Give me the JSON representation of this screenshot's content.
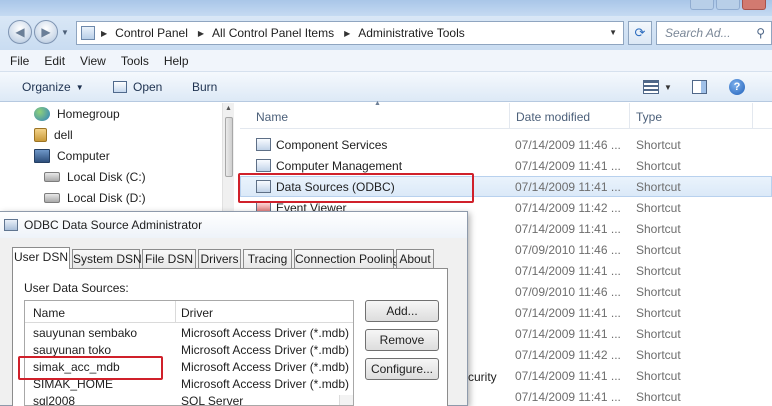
{
  "explorer": {
    "breadcrumb": [
      "Control Panel",
      "All Control Panel Items",
      "Administrative Tools"
    ],
    "search_placeholder": "Search Ad...",
    "menu": [
      "File",
      "Edit",
      "View",
      "Tools",
      "Help"
    ],
    "toolbar": {
      "organize": "Organize",
      "open": "Open",
      "burn": "Burn"
    },
    "nav": [
      {
        "label": "Homegroup",
        "icon": "homegroup-icon"
      },
      {
        "label": "dell",
        "icon": "user-folder-icon"
      },
      {
        "label": "Computer",
        "icon": "computer-icon"
      },
      {
        "label": "Local Disk (C:)",
        "icon": "disk-icon"
      },
      {
        "label": "Local Disk (D:)",
        "icon": "disk-icon"
      }
    ],
    "columns": {
      "name": "Name",
      "date": "Date modified",
      "type": "Type"
    },
    "files": [
      {
        "name": "Component Services",
        "date": "07/14/2009 11:46 ...",
        "type": "Shortcut"
      },
      {
        "name": "Computer Management",
        "date": "07/14/2009 11:41 ...",
        "type": "Shortcut"
      },
      {
        "name": "Data Sources (ODBC)",
        "date": "07/14/2009 11:41 ...",
        "type": "Shortcut"
      },
      {
        "name": "Event Viewer",
        "date": "07/14/2009 11:42 ...",
        "type": "Shortcut"
      },
      {
        "name": "",
        "date": "07/14/2009 11:41 ...",
        "type": "Shortcut"
      },
      {
        "name": "",
        "date": "07/09/2010 11:46 ...",
        "type": "Shortcut"
      },
      {
        "name": "",
        "date": "07/14/2009 11:41 ...",
        "type": "Shortcut"
      },
      {
        "name": "",
        "date": "07/09/2010 11:46 ...",
        "type": "Shortcut"
      },
      {
        "name": "",
        "date": "07/14/2009 11:41 ...",
        "type": "Shortcut"
      },
      {
        "name": "",
        "date": "07/14/2009 11:41 ...",
        "type": "Shortcut"
      },
      {
        "name": "",
        "date": "07/14/2009 11:42 ...",
        "type": "Shortcut"
      },
      {
        "name": "",
        "date": "07/14/2009 11:41 ...",
        "type": "Shortcut"
      },
      {
        "name": "",
        "date": "07/14/2009 11:41 ...",
        "type": "Shortcut"
      }
    ],
    "partial_text": "curity"
  },
  "dialog": {
    "title": "ODBC Data Source Administrator",
    "tabs": [
      "User DSN",
      "System DSN",
      "File DSN",
      "Drivers",
      "Tracing",
      "Connection Pooling",
      "About"
    ],
    "list_label": "User Data Sources:",
    "list_columns": {
      "name": "Name",
      "driver": "Driver"
    },
    "rows": [
      {
        "name": "sauyunan sembako",
        "driver": "Microsoft Access Driver (*.mdb)"
      },
      {
        "name": "sauyunan toko",
        "driver": "Microsoft Access Driver (*.mdb)"
      },
      {
        "name": "simak_acc_mdb",
        "driver": "Microsoft Access Driver (*.mdb)"
      },
      {
        "name": "SIMAK_HOME",
        "driver": "Microsoft Access Driver (*.mdb)"
      },
      {
        "name": "sql2008",
        "driver": "SQL Server"
      }
    ],
    "buttons": {
      "add": "Add...",
      "remove": "Remove",
      "configure": "Configure..."
    }
  },
  "colors": {
    "highlight_box": "#d0202a",
    "selection": "#dbe9f8",
    "toolbar": "#dde9f6"
  }
}
